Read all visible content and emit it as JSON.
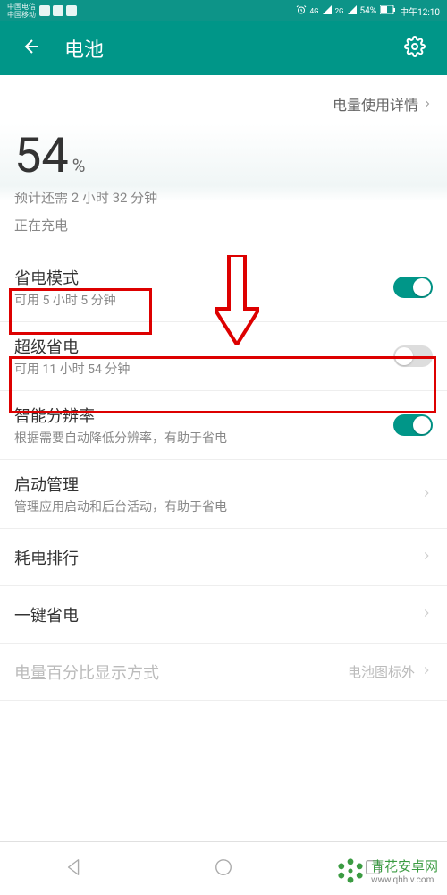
{
  "status_bar": {
    "carrier1": "中国电信",
    "carrier2": "中国移动",
    "signal1": "4G",
    "signal2": "2G",
    "battery_pct": "54%",
    "time_label": "中午12:10"
  },
  "header": {
    "title": "电池"
  },
  "usage_link": "电量使用详情",
  "battery": {
    "percent": "54",
    "symbol": "%",
    "estimate": "预计还需 2 小时 32 分钟",
    "charging": "正在充电"
  },
  "items": [
    {
      "title": "省电模式",
      "sub": "可用 5 小时 5 分钟",
      "type": "toggle",
      "on": true
    },
    {
      "title": "超级省电",
      "sub": "可用 11 小时 54 分钟",
      "type": "toggle",
      "on": false
    },
    {
      "title": "智能分辨率",
      "sub": "根据需要自动降低分辨率，有助于省电",
      "type": "toggle",
      "on": true
    },
    {
      "title": "启动管理",
      "sub": "管理应用启动和后台活动，有助于省电",
      "type": "link"
    },
    {
      "title": "耗电排行",
      "sub": "",
      "type": "link"
    },
    {
      "title": "一键省电",
      "sub": "",
      "type": "link"
    },
    {
      "title": "电量百分比显示方式",
      "sub": "",
      "type": "value",
      "value": "电池图标外",
      "dim": true
    }
  ],
  "watermark": {
    "title": "青花安卓网",
    "url": "www.qhhlv.com"
  },
  "colors": {
    "accent": "#009688",
    "annotation": "#d00"
  }
}
